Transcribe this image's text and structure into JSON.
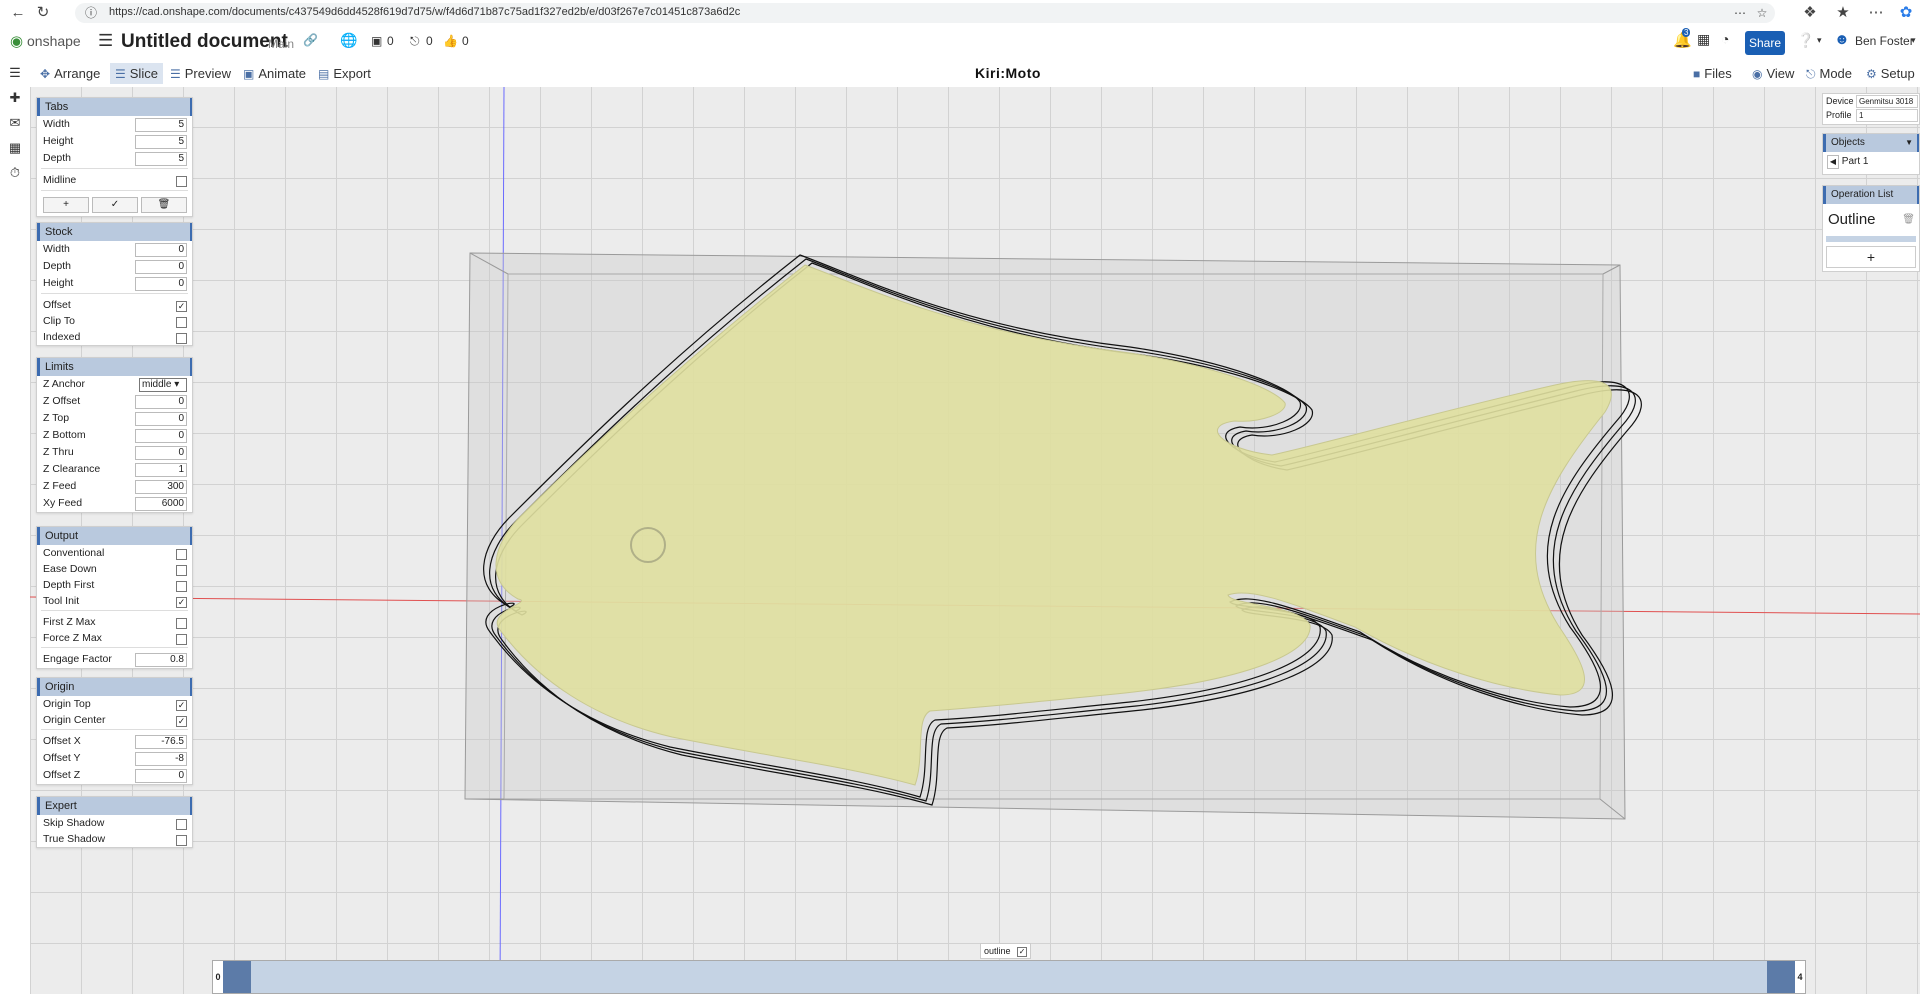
{
  "browser": {
    "url": "https://cad.onshape.com/documents/c437549d6dd4528f619d7d75/w/f4d6d71b87c75ad1f327ed2b/e/d03f267e7c01451c873a6d2c",
    "icons": [
      "back-icon",
      "refresh-icon",
      "info-icon",
      "more-icon",
      "star-icon",
      "extensions-icon",
      "favorites-icon",
      "menu-icon",
      "copilot-icon"
    ]
  },
  "header": {
    "logo": "onshape",
    "title": "Untitled document",
    "branch": "Main",
    "versions_count": "0",
    "branches_count": "0",
    "likes_count": "0",
    "notifications_count": "3",
    "share_label": "Share",
    "user_name": "Ben Foster"
  },
  "toolbar": {
    "arrange": "Arrange",
    "slice": "Slice",
    "preview": "Preview",
    "animate": "Animate",
    "export": "Export",
    "brand": "Kiri:Moto",
    "files": "Files",
    "view": "View",
    "mode": "Mode",
    "setup": "Setup"
  },
  "tabs_panel": {
    "title": "Tabs",
    "width_label": "Width",
    "width": "5",
    "height_label": "Height",
    "height": "5",
    "depth_label": "Depth",
    "depth": "5",
    "midline_label": "Midline"
  },
  "stock_panel": {
    "title": "Stock",
    "width_label": "Width",
    "width": "0",
    "depth_label": "Depth",
    "depth": "0",
    "height_label": "Height",
    "height": "0",
    "offset_label": "Offset",
    "clipto_label": "Clip To",
    "indexed_label": "Indexed"
  },
  "limits_panel": {
    "title": "Limits",
    "zanchor_label": "Z Anchor",
    "zanchor": "middle",
    "zoffset_label": "Z Offset",
    "zoffset": "0",
    "ztop_label": "Z Top",
    "ztop": "0",
    "zbottom_label": "Z Bottom",
    "zbottom": "0",
    "zthru_label": "Z Thru",
    "zthru": "0",
    "zclearance_label": "Z Clearance",
    "zclearance": "1",
    "zfeed_label": "Z Feed",
    "zfeed": "300",
    "xyfeed_label": "Xy Feed",
    "xyfeed": "6000"
  },
  "output_panel": {
    "title": "Output",
    "conventional_label": "Conventional",
    "easedown_label": "Ease Down",
    "depthfirst_label": "Depth First",
    "toolinit_label": "Tool Init",
    "firstzmax_label": "First Z Max",
    "forcezmax_label": "Force Z Max",
    "engage_label": "Engage Factor",
    "engage": "0.8"
  },
  "origin_panel": {
    "title": "Origin",
    "origintop_label": "Origin Top",
    "origincenter_label": "Origin Center",
    "offsetx_label": "Offset X",
    "offsetx": "-76.5",
    "offsety_label": "Offset Y",
    "offsety": "-8",
    "offsetz_label": "Offset Z",
    "offsetz": "0"
  },
  "expert_panel": {
    "title": "Expert",
    "skipshadow_label": "Skip Shadow",
    "trueshadow_label": "True Shadow"
  },
  "right": {
    "device_label": "Device",
    "device": "Genmitsu 3018",
    "profile_label": "Profile",
    "profile": "1",
    "objects_title": "Objects",
    "part": "Part 1",
    "oplist_title": "Operation List",
    "operation": "Outline",
    "add": "+"
  },
  "bottom": {
    "outline_label": "outline",
    "layer_start": "0",
    "layer_end": "4"
  },
  "colors": {
    "part_fill": "#e0e0a0",
    "panel_header": "#b9c9de",
    "accent": "#3d6cb0",
    "share": "#1a5fb4"
  }
}
